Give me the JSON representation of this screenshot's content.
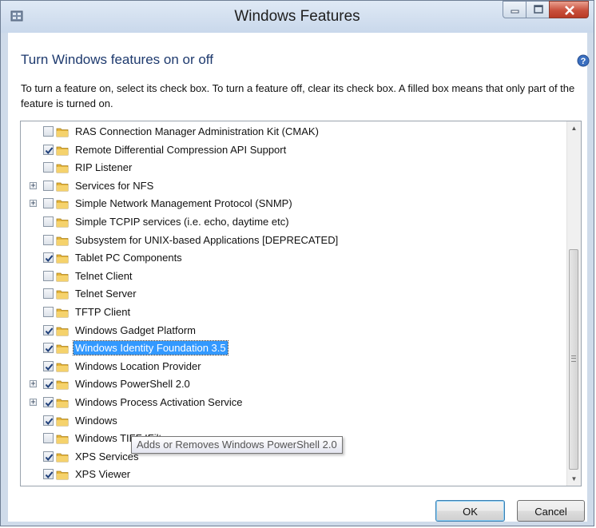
{
  "window": {
    "title": "Windows Features",
    "controls": [
      "minimize",
      "maximize",
      "close"
    ]
  },
  "heading": "Turn Windows features on or off",
  "description": "To turn a feature on, select its check box. To turn a feature off, clear its check box. A filled box means that only part of the feature is turned on.",
  "features": [
    {
      "label": "RAS Connection Manager Administration Kit (CMAK)",
      "checked": false,
      "expandable": false
    },
    {
      "label": "Remote Differential Compression API Support",
      "checked": true,
      "expandable": false
    },
    {
      "label": "RIP Listener",
      "checked": false,
      "expandable": false
    },
    {
      "label": "Services for NFS",
      "checked": false,
      "expandable": true
    },
    {
      "label": "Simple Network Management Protocol (SNMP)",
      "checked": false,
      "expandable": true
    },
    {
      "label": "Simple TCPIP services (i.e. echo, daytime etc)",
      "checked": false,
      "expandable": false
    },
    {
      "label": "Subsystem for UNIX-based Applications [DEPRECATED]",
      "checked": false,
      "expandable": false
    },
    {
      "label": "Tablet PC Components",
      "checked": true,
      "expandable": false
    },
    {
      "label": "Telnet Client",
      "checked": false,
      "expandable": false
    },
    {
      "label": "Telnet Server",
      "checked": false,
      "expandable": false
    },
    {
      "label": "TFTP Client",
      "checked": false,
      "expandable": false
    },
    {
      "label": "Windows Gadget Platform",
      "checked": true,
      "expandable": false
    },
    {
      "label": "Windows Identity Foundation 3.5",
      "checked": true,
      "expandable": false,
      "selected": true
    },
    {
      "label": "Windows Location Provider",
      "checked": true,
      "expandable": false
    },
    {
      "label": "Windows PowerShell 2.0",
      "checked": true,
      "expandable": true
    },
    {
      "label": "Windows Process Activation Service",
      "checked": true,
      "expandable": true
    },
    {
      "label": "Windows",
      "checked": true,
      "expandable": false
    },
    {
      "label": "Windows TIFF IFilter",
      "checked": false,
      "expandable": false
    },
    {
      "label": "XPS Services",
      "checked": true,
      "expandable": false
    },
    {
      "label": "XPS Viewer",
      "checked": true,
      "expandable": false
    }
  ],
  "tooltip": "Adds or Removes Windows PowerShell 2.0",
  "buttons": {
    "ok": "OK",
    "cancel": "Cancel"
  },
  "colors": {
    "heading": "#1e3a6e",
    "selection": "#3399ff",
    "close_button": "#c9503c"
  },
  "icons": {
    "app": "windows-features-icon",
    "help": "help-icon",
    "feature": "folder-icon",
    "check": "checkmark-icon"
  }
}
